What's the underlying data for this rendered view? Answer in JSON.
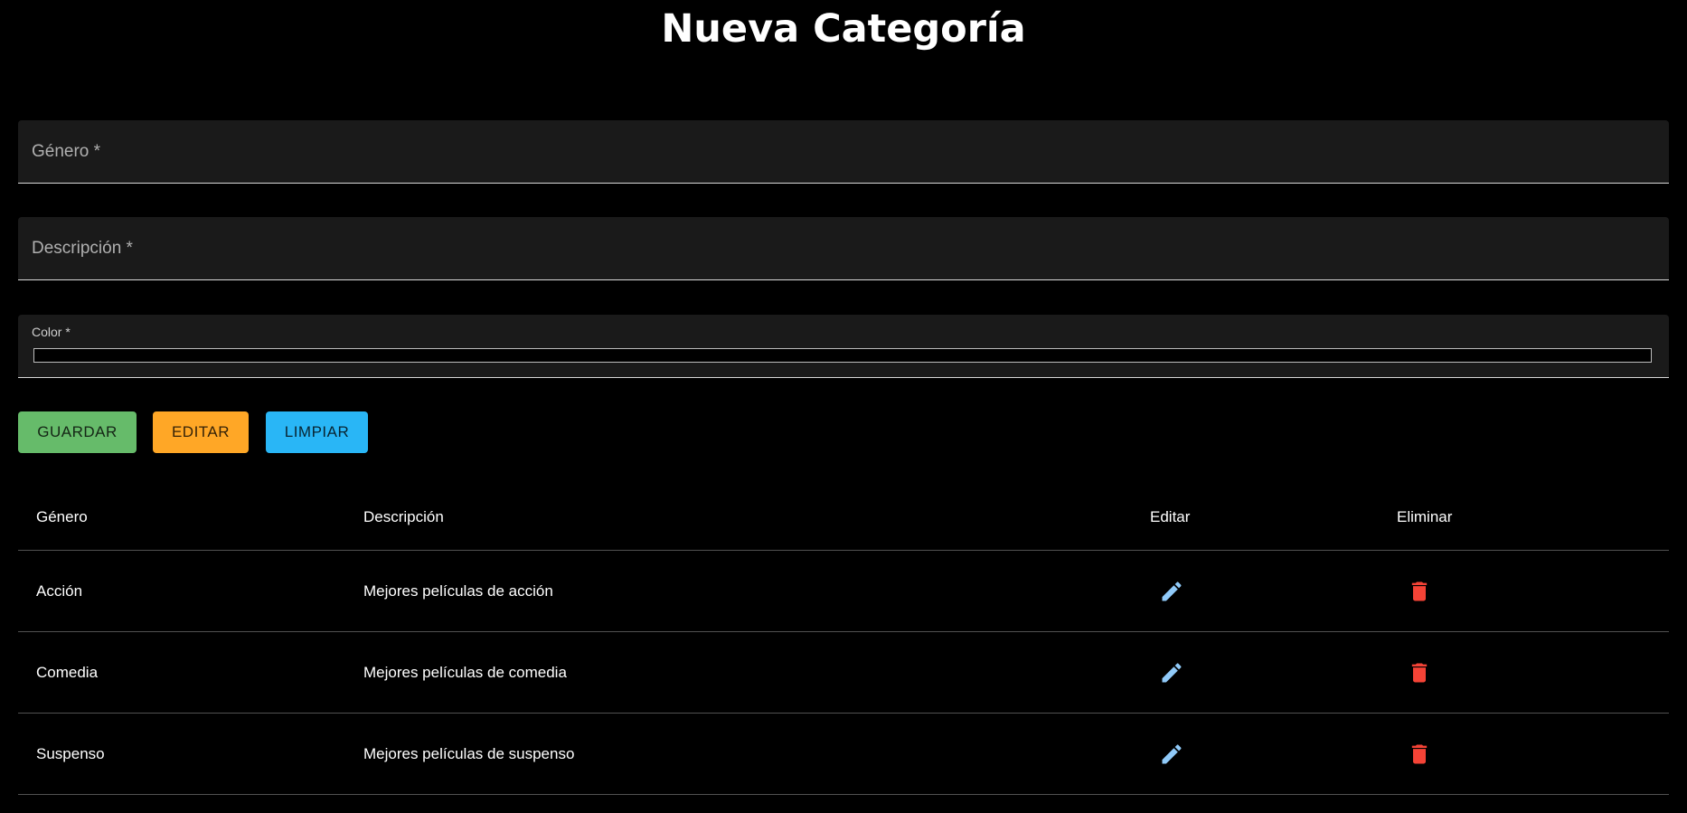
{
  "page": {
    "title": "Nueva Categoría"
  },
  "form": {
    "genero_label": "Género *",
    "genero_value": "",
    "descripcion_label": "Descripción *",
    "descripcion_value": "",
    "color_label": "Color *"
  },
  "buttons": {
    "guardar": "GUARDAR",
    "editar": "EDITAR",
    "limpiar": "LIMPIAR"
  },
  "table": {
    "headers": {
      "genero": "Género",
      "descripcion": "Descripción",
      "editar": "Editar",
      "eliminar": "Eliminar"
    },
    "rows": [
      {
        "genero": "Acción",
        "descripcion": "Mejores películas de acción"
      },
      {
        "genero": "Comedia",
        "descripcion": "Mejores películas de comedia"
      },
      {
        "genero": "Suspenso",
        "descripcion": "Mejores películas de suspenso"
      }
    ]
  },
  "icons": {
    "edit": "pencil-icon",
    "delete": "trash-icon"
  },
  "colors": {
    "background": "#000000",
    "field_background": "#1a1a1a",
    "guardar": "#66bb6a",
    "editar": "#ffa726",
    "limpiar": "#29b6f6",
    "edit_icon": "#90caf9",
    "delete_icon": "#f44336"
  }
}
